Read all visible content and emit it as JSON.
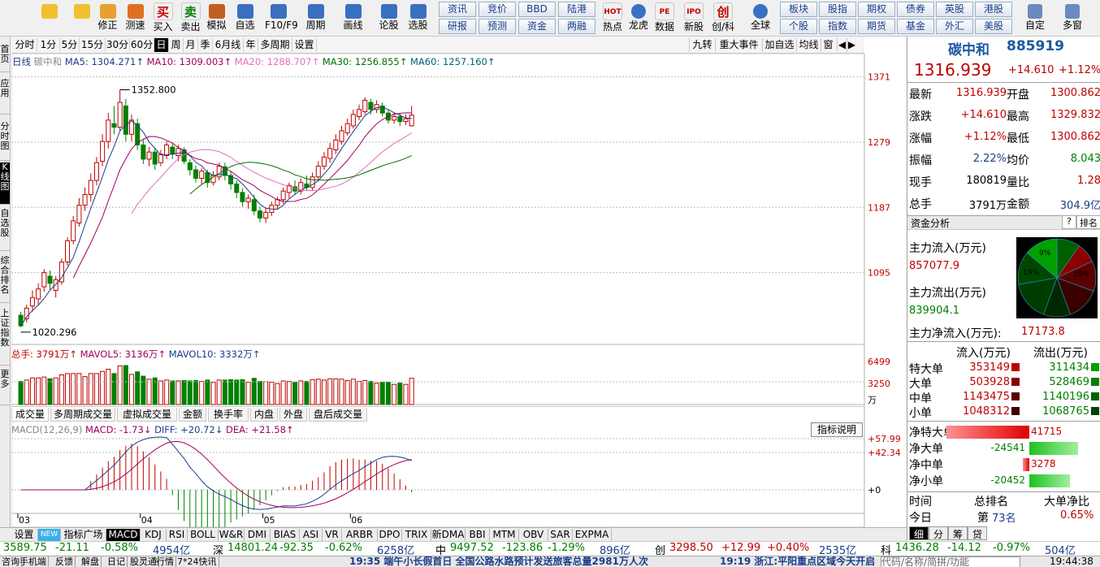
{
  "toolbar": {
    "buttons": [
      {
        "label": "",
        "icon": "back-arrow-icon"
      },
      {
        "label": "",
        "icon": "up-home-icon"
      },
      {
        "label": "修正",
        "icon": "edit-icon"
      },
      {
        "label": "测速",
        "icon": "clock-icon"
      },
      {
        "label": "买入",
        "icon": "buy-icon",
        "glyph": "买"
      },
      {
        "label": "卖出",
        "icon": "sell-icon",
        "glyph": "卖"
      },
      {
        "label": "模拟",
        "icon": "hammer-icon"
      },
      {
        "label": "自选",
        "icon": "star-folder-icon"
      },
      {
        "label": "F10/F9",
        "icon": "f10-icon"
      },
      {
        "label": "周期",
        "icon": "period-icon"
      },
      {
        "label": "画线",
        "icon": "pen-icon"
      },
      {
        "label": "论股",
        "icon": "forum-icon"
      },
      {
        "label": "选股",
        "icon": "pick-stock-icon"
      }
    ],
    "small_buttons_top": [
      "资讯",
      "竞价",
      "BBD",
      "陆港"
    ],
    "small_buttons_bottom": [
      "研报",
      "预测",
      "资金",
      "两融"
    ],
    "buttons2": [
      {
        "label": "热点",
        "icon": "hot-icon",
        "glyph": "HOT"
      },
      {
        "label": "龙虎",
        "icon": "dragon-icon"
      },
      {
        "label": "数据",
        "icon": "pe-icon",
        "glyph": "PE"
      },
      {
        "label": "新股",
        "icon": "ipo-icon",
        "glyph": "IPO"
      },
      {
        "label": "创/科",
        "icon": "chuang-icon",
        "glyph": "创"
      },
      {
        "label": "全球",
        "icon": "globe-icon"
      }
    ],
    "small_buttons2_top": [
      "板块",
      "股指",
      "期权",
      "债券",
      "英股",
      "港股"
    ],
    "small_buttons2_bottom": [
      "个股",
      "指数",
      "期货",
      "基金",
      "外汇",
      "美股"
    ],
    "buttons3": [
      {
        "label": "自定",
        "icon": "custom-icon"
      },
      {
        "label": "多窗",
        "icon": "multiwindow-icon"
      }
    ]
  },
  "left_tabs": [
    "首页",
    "应用",
    "分时图",
    "K线图",
    "自选股",
    "综合排名",
    "上证指数",
    "更多"
  ],
  "periods": [
    "分时",
    "1分",
    "5分",
    "15分",
    "30分",
    "60分",
    "日",
    "周",
    "月",
    "季",
    "6月线",
    "年",
    "多周期",
    "设置"
  ],
  "active_period": "日",
  "right_tools": [
    "九转",
    "重大事件",
    "加自选",
    "均线",
    "窗"
  ],
  "ma_legend": {
    "type": "日线",
    "name": "碳中和",
    "ma5": "MA5: 1304.271↑",
    "ma10": "MA10: 1309.003↑",
    "ma20": "MA20: 1288.707↑",
    "ma30": "MA30: 1256.855↑",
    "ma60": "MA60: 1257.160↑"
  },
  "price_axis": [
    "1371",
    "1279",
    "1187",
    "1095"
  ],
  "high_label": "1352.800",
  "low_label": "1020.296",
  "volume_legend": {
    "total": "总手: 3791万↑",
    "mavol5": "MAVOL5: 3136万↑",
    "mavol10": "MAVOL10: 3332万↑"
  },
  "volume_axis": [
    "6499",
    "3250",
    "万"
  ],
  "volume_tabs": [
    "成交量",
    "多周期成交量",
    "虚拟成交量",
    "金额",
    "换手率",
    "内盘",
    "外盘",
    "盘后成交量"
  ],
  "macd_legend": {
    "name": "MACD(12,26,9)",
    "macd": "MACD: -1.73↓",
    "diff": "DIFF: +20.72↓",
    "dea": "DEA: +21.58↑"
  },
  "macd_explain": "指标说明",
  "macd_axis": [
    "+57.99",
    "+42.34",
    "+0"
  ],
  "month_labels": [
    "03",
    "04",
    "05",
    "06"
  ],
  "indicator_tabs": [
    "设置",
    "NEW",
    "指标广场",
    "MACD",
    "KDJ",
    "RSI",
    "BOLL",
    "W&R",
    "DMI",
    "BIAS",
    "ASI",
    "VR",
    "ARBR",
    "DPO",
    "TRIX",
    "新DMA",
    "BBI",
    "MTM",
    "OBV",
    "SAR",
    "EXPMA"
  ],
  "active_indicator": "MACD",
  "quote": {
    "name": "碳中和",
    "code": "885919",
    "price": "1316.939",
    "change": "+14.610",
    "pct": "+1.12%",
    "rows": [
      {
        "l": "最新",
        "v": "1316.939",
        "l2": "开盘",
        "v2": "1300.862"
      },
      {
        "l": "涨跌",
        "v": "+14.610",
        "l2": "最高",
        "v2": "1329.832"
      },
      {
        "l": "涨幅",
        "v": "+1.12%",
        "l2": "最低",
        "v2": "1300.862"
      },
      {
        "l": "振幅",
        "v": "2.22%",
        "l2": "均价",
        "v2": "8.043"
      },
      {
        "l": "现手",
        "v": "180819",
        "l2": "量比",
        "v2": "1.28"
      },
      {
        "l": "总手",
        "v": "3791万",
        "l2": "金额",
        "v2": "304.9亿"
      }
    ]
  },
  "fund": {
    "title": "资金分析",
    "help": "?",
    "rank": "排名",
    "inflow_label": "主力流入(万元)",
    "inflow": "857077.9",
    "outflow_label": "主力流出(万元)",
    "outflow": "839904.1",
    "net_label": "主力净流入(万元):",
    "net": "17173.8",
    "pie_labels": [
      "9%",
      "19%",
      "19%"
    ],
    "table_headers": [
      "流入(万元)",
      "流出(万元)"
    ],
    "table_rows": [
      {
        "l": "特大单",
        "in": "353149",
        "out": "311434"
      },
      {
        "l": "大单",
        "in": "503928",
        "out": "528469"
      },
      {
        "l": "中单",
        "in": "1143475",
        "out": "1140196"
      },
      {
        "l": "小单",
        "in": "1048312",
        "out": "1068765"
      }
    ],
    "net_rows": [
      {
        "l": "净特大单",
        "v": "41715",
        "v_num": 41715
      },
      {
        "l": "净大单",
        "v": "-24541",
        "v_num": -24541
      },
      {
        "l": "净中单",
        "v": "3278",
        "v_num": 3278
      },
      {
        "l": "净小单",
        "v": "-20452",
        "v_num": -20452
      }
    ],
    "rank_headers": [
      "时间",
      "总排名",
      "大单净比"
    ],
    "rank_rows": [
      {
        "t": "今日",
        "r1": "第",
        "r2": "73名",
        "v": "0.65%"
      }
    ],
    "bottom_tabs": [
      "细",
      "分",
      "筹",
      "贷"
    ]
  },
  "index_bar": {
    "items": [
      {
        "v": "3589.75",
        "c": "-21.11",
        "p": "-0.58%",
        "a": "4954亿"
      },
      {
        "n": "深",
        "v": "14801.24",
        "c": "-92.35",
        "p": "-0.62%",
        "a": "6258亿"
      },
      {
        "n": "中",
        "v": "9497.52",
        "c": "-123.86",
        "p": "-1.29%",
        "a": "896亿"
      },
      {
        "n": "创",
        "v": "3298.50",
        "c": "+12.99",
        "p": "+0.40%",
        "a": "2535亿"
      },
      {
        "n": "科",
        "v": "1436.28",
        "c": "-14.12",
        "p": "-0.97%",
        "a": "504亿"
      }
    ]
  },
  "news_bar": {
    "tabs": [
      "咨询",
      "手机端",
      "反馈",
      "解盘",
      "日记",
      "股灵通",
      "行情",
      "7*24快讯"
    ],
    "headline1": "19:35 端午小长假首日 全国公路水路预计发送旅客总量2981万人次",
    "headline2": "19:19 浙江:平阳重点区域今天开启",
    "right": "代码/名称/简拼/功能",
    "clock": "19:44:38"
  },
  "chart_data": {
    "type": "candlestick",
    "price_range": [
      1003,
      1390
    ],
    "candles": [
      [
        1035,
        1020,
        1040,
        1018
      ],
      [
        1030,
        1045,
        1050,
        1025
      ],
      [
        1048,
        1060,
        1070,
        1040
      ],
      [
        1058,
        1072,
        1080,
        1050
      ],
      [
        1075,
        1095,
        1100,
        1068
      ],
      [
        1090,
        1080,
        1098,
        1070
      ],
      [
        1070,
        1085,
        1090,
        1060
      ],
      [
        1082,
        1110,
        1115,
        1078
      ],
      [
        1110,
        1140,
        1145,
        1105
      ],
      [
        1140,
        1168,
        1175,
        1135
      ],
      [
        1165,
        1190,
        1200,
        1160
      ],
      [
        1190,
        1205,
        1215,
        1182
      ],
      [
        1205,
        1225,
        1235,
        1195
      ],
      [
        1225,
        1250,
        1258,
        1218
      ],
      [
        1252,
        1280,
        1290,
        1245
      ],
      [
        1280,
        1310,
        1320,
        1270
      ],
      [
        1305,
        1300,
        1330,
        1290
      ],
      [
        1300,
        1335,
        1352.8,
        1295
      ],
      [
        1330,
        1290,
        1340,
        1280
      ],
      [
        1290,
        1310,
        1318,
        1280
      ],
      [
        1305,
        1275,
        1312,
        1268
      ],
      [
        1275,
        1255,
        1282,
        1248
      ],
      [
        1255,
        1265,
        1272,
        1245
      ],
      [
        1265,
        1248,
        1270,
        1240
      ],
      [
        1250,
        1262,
        1268,
        1245
      ],
      [
        1260,
        1275,
        1280,
        1255
      ],
      [
        1272,
        1262,
        1278,
        1255
      ],
      [
        1260,
        1270,
        1275,
        1252
      ],
      [
        1268,
        1252,
        1272,
        1248
      ],
      [
        1250,
        1240,
        1255,
        1232
      ],
      [
        1240,
        1228,
        1246,
        1222
      ],
      [
        1228,
        1238,
        1242,
        1220
      ],
      [
        1236,
        1222,
        1240,
        1215
      ],
      [
        1222,
        1232,
        1238,
        1218
      ],
      [
        1230,
        1245,
        1250,
        1225
      ],
      [
        1244,
        1232,
        1250,
        1225
      ],
      [
        1232,
        1220,
        1238,
        1212
      ],
      [
        1220,
        1208,
        1225,
        1200
      ],
      [
        1208,
        1195,
        1214,
        1188
      ],
      [
        1195,
        1200,
        1205,
        1185
      ],
      [
        1198,
        1182,
        1205,
        1176
      ],
      [
        1182,
        1172,
        1188,
        1166
      ],
      [
        1172,
        1180,
        1186,
        1165
      ],
      [
        1180,
        1190,
        1195,
        1175
      ],
      [
        1190,
        1198,
        1202,
        1185
      ],
      [
        1198,
        1210,
        1215,
        1192
      ],
      [
        1208,
        1218,
        1222,
        1200
      ],
      [
        1216,
        1210,
        1225,
        1205
      ],
      [
        1210,
        1222,
        1228,
        1205
      ],
      [
        1220,
        1215,
        1232,
        1210
      ],
      [
        1215,
        1230,
        1236,
        1210
      ],
      [
        1230,
        1245,
        1252,
        1225
      ],
      [
        1245,
        1258,
        1265,
        1240
      ],
      [
        1256,
        1270,
        1278,
        1250
      ],
      [
        1268,
        1282,
        1290,
        1262
      ],
      [
        1280,
        1295,
        1302,
        1275
      ],
      [
        1292,
        1305,
        1312,
        1288
      ],
      [
        1302,
        1318,
        1325,
        1298
      ],
      [
        1315,
        1325,
        1332,
        1310
      ],
      [
        1322,
        1338,
        1342,
        1318
      ],
      [
        1335,
        1325,
        1340,
        1318
      ],
      [
        1325,
        1332,
        1338,
        1320
      ],
      [
        1330,
        1320,
        1335,
        1315
      ],
      [
        1320,
        1310,
        1325,
        1305
      ],
      [
        1310,
        1315,
        1320,
        1305
      ],
      [
        1315,
        1308,
        1320,
        1302
      ],
      [
        1308,
        1312,
        1318,
        1303
      ],
      [
        1302,
        1317,
        1330,
        1301
      ]
    ],
    "volume_max": 6499
  }
}
